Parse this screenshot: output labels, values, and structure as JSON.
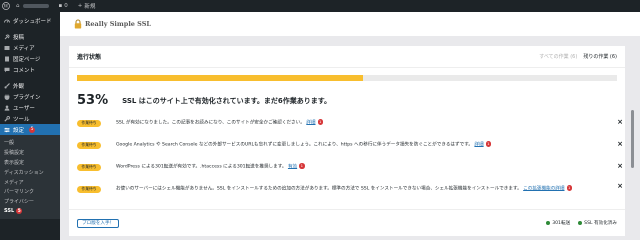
{
  "adminbar": {
    "comments_count": "0",
    "new_label": "新規"
  },
  "sidebar": {
    "dashboard": "ダッシュボード",
    "posts": "投稿",
    "media": "メディア",
    "pages": "固定ページ",
    "comments": "コメント",
    "appearance": "外観",
    "plugins": "プラグイン",
    "users": "ユーザー",
    "tools": "ツール",
    "settings": "設定",
    "settings_badge": "5",
    "submenu": [
      "一般",
      "投稿設定",
      "表示設定",
      "ディスカッション",
      "メディア",
      "パーマリンク",
      "プライバシー"
    ],
    "ssl_label": "SSL",
    "ssl_badge": "5"
  },
  "header": {
    "logo_text": "Really Simple SSL"
  },
  "card": {
    "title": "進行状態",
    "filter_all": "すべての作業 (6)",
    "filter_remaining": "残りの作業 (6)",
    "progress_percent": 53,
    "score": "53%",
    "score_text": "SSL はこのサイト上で有効化されています。まだ6作業あります。",
    "tasks": [
      {
        "pill": "作業待ち",
        "text": "SSL が有効になりました。この記事をお読みになり、このサイトが安全かご確認ください。",
        "link": "詳細",
        "num": "1"
      },
      {
        "pill": "作業待ち",
        "text": "Google Analytics や Search Console などの外部サービスのURLも忘れずに変更しましょう。これにより、https への移行に伴うデータ損失を防ぐことができるはずです。",
        "link": "詳細",
        "num": "1"
      },
      {
        "pill": "作業待ち",
        "text": "WordPress による301転送が有効です。.htaccess による301転送を推奨します。",
        "link": "有効",
        "num": "1"
      },
      {
        "pill": "作業待ち",
        "text": "お使いのサーバーにはシェル機能がありません。SSL をインストールするための追加の方法があります。標準の方法で SSL をインストールできない場合、シェル拡張機能をインストールできます。",
        "link": "この拡張機能の詳細",
        "num": "1"
      }
    ],
    "pro_button": "プロ版を入手！",
    "legend_redirect": "301転送",
    "legend_ssl": "SSL 有効化済み"
  }
}
